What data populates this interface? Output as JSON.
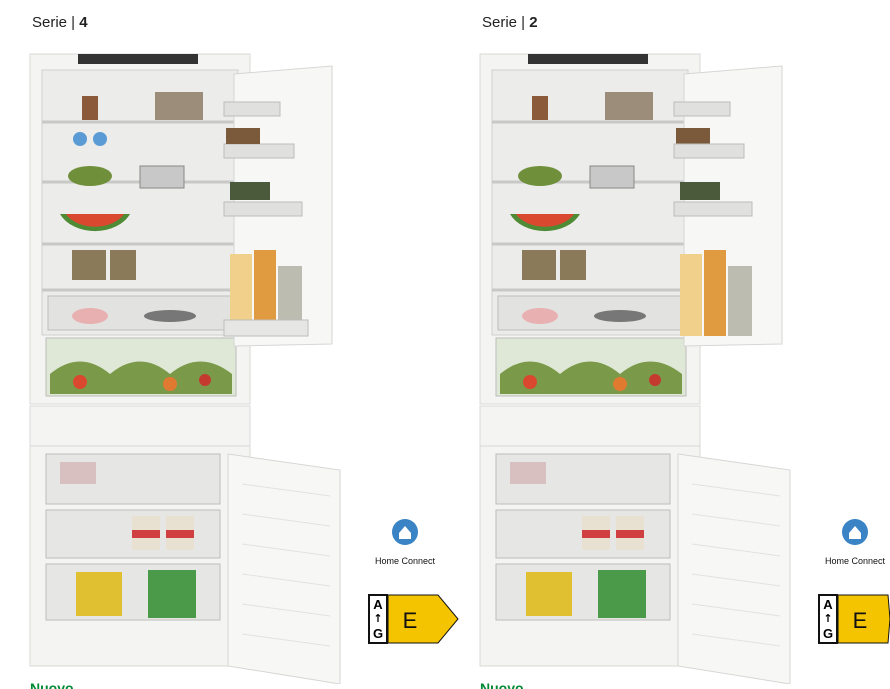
{
  "products": [
    {
      "series_label": "Serie | ",
      "series_number": "4",
      "home_connect_label": "Home Connect",
      "energy": {
        "top": "A",
        "bottom": "G",
        "class": "E"
      },
      "badge": "Nuovo"
    },
    {
      "series_label": "Serie | ",
      "series_number": "2",
      "home_connect_label": "Home Connect",
      "energy": {
        "top": "A",
        "bottom": "G",
        "class": "E"
      },
      "badge": "Nuovo"
    }
  ],
  "colors": {
    "energy_yellow": "#f5c400",
    "home_connect_blue": "#3a83c4",
    "badge_green": "#008a33"
  }
}
